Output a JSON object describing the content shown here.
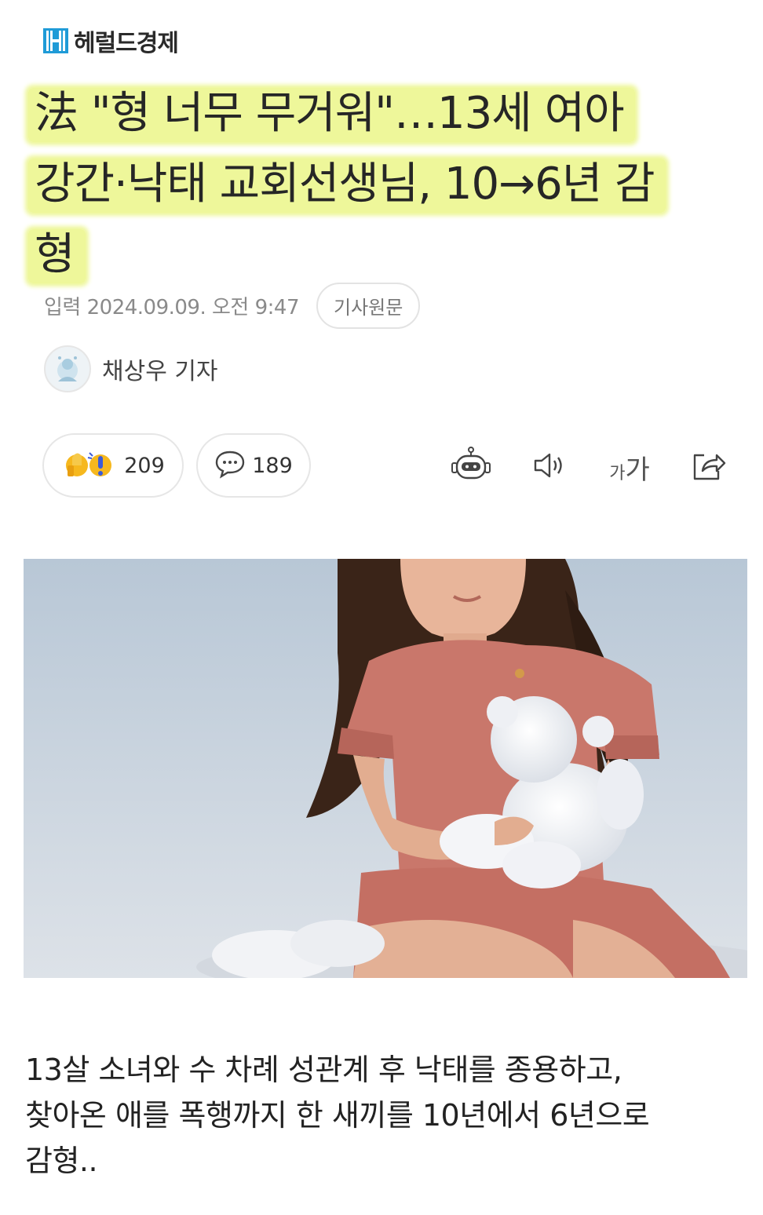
{
  "publisher": {
    "name": "헤럴드경제",
    "logo_icon": "herald-h-logo-icon",
    "brand_color": "#1f9bd7"
  },
  "headline": {
    "lines": [
      "法 \"형 너무 무거워\"…13세 여아",
      "강간·낙태 교회선생님, 10→6년 감",
      "형"
    ],
    "highlight_color": "#eef79a"
  },
  "meta": {
    "date": "입력 2024.09.09. 오전 9:47",
    "original_button": "기사원문"
  },
  "reporter": {
    "name": "채상우 기자",
    "avatar_icon": "reporter-avatar-icon"
  },
  "actions": {
    "reaction_count": "209",
    "comment_count": "189",
    "font_size_label_small": "가",
    "font_size_label_large": "가",
    "icons": [
      "reaction-emoji-icon",
      "comment-bubble-icon",
      "robot-summary-icon",
      "speaker-icon",
      "font-size-icon",
      "share-icon"
    ]
  },
  "photo": {
    "subject": "girl-with-teddy-bear-image"
  },
  "body": {
    "lines": [
      "13살 소녀와 수 차례 성관계 후 낙태를 종용하고,",
      "찾아온 애를 폭행까지 한 새끼를 10년에서 6년으로",
      "감형.."
    ]
  }
}
